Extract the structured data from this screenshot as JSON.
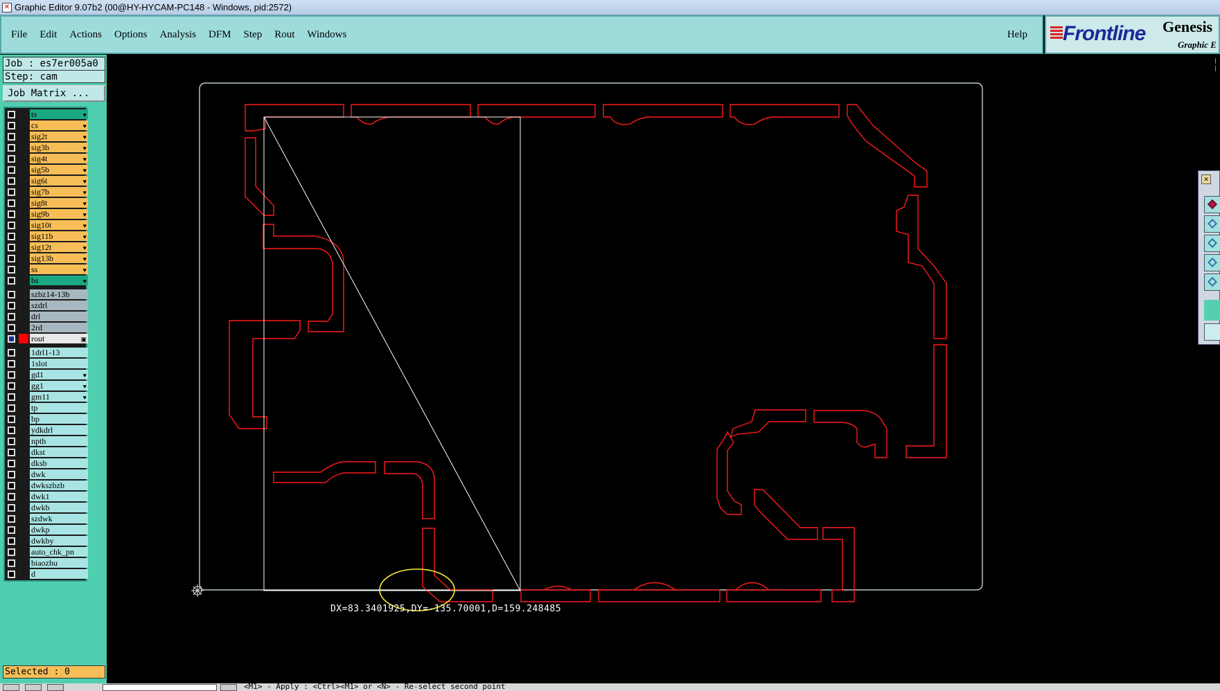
{
  "window": {
    "title": "Graphic Editor 9.07b2 (00@HY-HYCAM-PC148 - Windows, pid:2572)"
  },
  "menu": {
    "items": [
      "File",
      "Edit",
      "Actions",
      "Options",
      "Analysis",
      "DFM",
      "Step",
      "Rout",
      "Windows"
    ],
    "help": "Help"
  },
  "brand": {
    "logo": "Frontline",
    "product": "Genesis",
    "subtitle": "Graphic E"
  },
  "job": {
    "job_line": "Job : es7er005a0",
    "step_line": "Step: cam",
    "matrix_button": "Job Matrix ..."
  },
  "layers": [
    {
      "name": "ts",
      "color": "#1aa882",
      "mark": "♥",
      "group": 1
    },
    {
      "name": "cs",
      "color": "#f7be58",
      "mark": "♥",
      "group": 1
    },
    {
      "name": "sig2t",
      "color": "#f7be58",
      "mark": "♥",
      "group": 1
    },
    {
      "name": "sig3b",
      "color": "#f7be58",
      "mark": "♥",
      "group": 1
    },
    {
      "name": "sig4t",
      "color": "#f7be58",
      "mark": "♥",
      "group": 1
    },
    {
      "name": "sig5b",
      "color": "#f7be58",
      "mark": "♥",
      "group": 1
    },
    {
      "name": "sig6t",
      "color": "#f7be58",
      "mark": "♥",
      "group": 1
    },
    {
      "name": "sig7b",
      "color": "#f7be58",
      "mark": "♥",
      "group": 1
    },
    {
      "name": "sig8t",
      "color": "#f7be58",
      "mark": "♥",
      "group": 1
    },
    {
      "name": "sig9b",
      "color": "#f7be58",
      "mark": "♥",
      "group": 1
    },
    {
      "name": "sig10t",
      "color": "#f7be58",
      "mark": "♥",
      "group": 1
    },
    {
      "name": "sig11b",
      "color": "#f7be58",
      "mark": "♥",
      "group": 1
    },
    {
      "name": "sig12t",
      "color": "#f7be58",
      "mark": "♥",
      "group": 1
    },
    {
      "name": "sig13b",
      "color": "#f7be58",
      "mark": "♥",
      "group": 1
    },
    {
      "name": "ss",
      "color": "#f7be58",
      "mark": "♥",
      "group": 1
    },
    {
      "name": "bs",
      "color": "#1aa882",
      "mark": "♥",
      "group": 1
    },
    {
      "name": "szbz14-13b",
      "color": "#a8b8c0",
      "mark": "",
      "group": 2
    },
    {
      "name": "szdrl",
      "color": "#a8b8c0",
      "mark": "",
      "group": 2
    },
    {
      "name": "drl",
      "color": "#a8b8c0",
      "mark": "",
      "group": 2
    },
    {
      "name": "2rd",
      "color": "#a8b8c0",
      "mark": "",
      "group": 2
    },
    {
      "name": "rout",
      "color": "#e8e8e8",
      "mark": "▣",
      "group": 2,
      "active": true,
      "swatch": "#ff0000"
    },
    {
      "name": "1drl1-13",
      "color": "#a9e4e4",
      "mark": "",
      "group": 3
    },
    {
      "name": "1slot",
      "color": "#a9e4e4",
      "mark": "",
      "group": 3
    },
    {
      "name": "gd1",
      "color": "#a9e4e4",
      "mark": "♥",
      "group": 3
    },
    {
      "name": "gg1",
      "color": "#a9e4e4",
      "mark": "♥",
      "group": 3
    },
    {
      "name": "gm11",
      "color": "#a9e4e4",
      "mark": "♥",
      "group": 3
    },
    {
      "name": "tp",
      "color": "#a9e4e4",
      "mark": "",
      "group": 3
    },
    {
      "name": "bp",
      "color": "#a9e4e4",
      "mark": "",
      "group": 3
    },
    {
      "name": "ydkdrl",
      "color": "#a9e4e4",
      "mark": "",
      "group": 3
    },
    {
      "name": "npth",
      "color": "#a9e4e4",
      "mark": "",
      "group": 3
    },
    {
      "name": "dkst",
      "color": "#a9e4e4",
      "mark": "",
      "group": 3
    },
    {
      "name": "dksb",
      "color": "#a9e4e4",
      "mark": "",
      "group": 3
    },
    {
      "name": "dwk",
      "color": "#a9e4e4",
      "mark": "",
      "group": 3
    },
    {
      "name": "dwkszbzb",
      "color": "#a9e4e4",
      "mark": "",
      "group": 3
    },
    {
      "name": "dwk1",
      "color": "#a9e4e4",
      "mark": "",
      "group": 3
    },
    {
      "name": "dwkb",
      "color": "#a9e4e4",
      "mark": "",
      "group": 3
    },
    {
      "name": "szdwk",
      "color": "#a9e4e4",
      "mark": "",
      "group": 3
    },
    {
      "name": "dwkp",
      "color": "#a9e4e4",
      "mark": "",
      "group": 3
    },
    {
      "name": "dwkby",
      "color": "#a9e4e4",
      "mark": "",
      "group": 3
    },
    {
      "name": "auto_chk_pn",
      "color": "#a9e4e4",
      "mark": "",
      "group": 3
    },
    {
      "name": "biaozhu",
      "color": "#a9e4e4",
      "mark": "",
      "group": 3
    },
    {
      "name": "d",
      "color": "#a9e4e4",
      "mark": "",
      "group": 3
    }
  ],
  "selected": "Selected : 0",
  "measurement": "DX=83.3401925,DY=-135.70001,D=159.248485",
  "status_hint": "<M1> - Apply  : <Ctrl><M1> or <N> - Re-select second point",
  "colors": {
    "rout_outline": "#ff1a1a",
    "profile": "#ffffff",
    "highlight_circle": "#ffee33"
  }
}
